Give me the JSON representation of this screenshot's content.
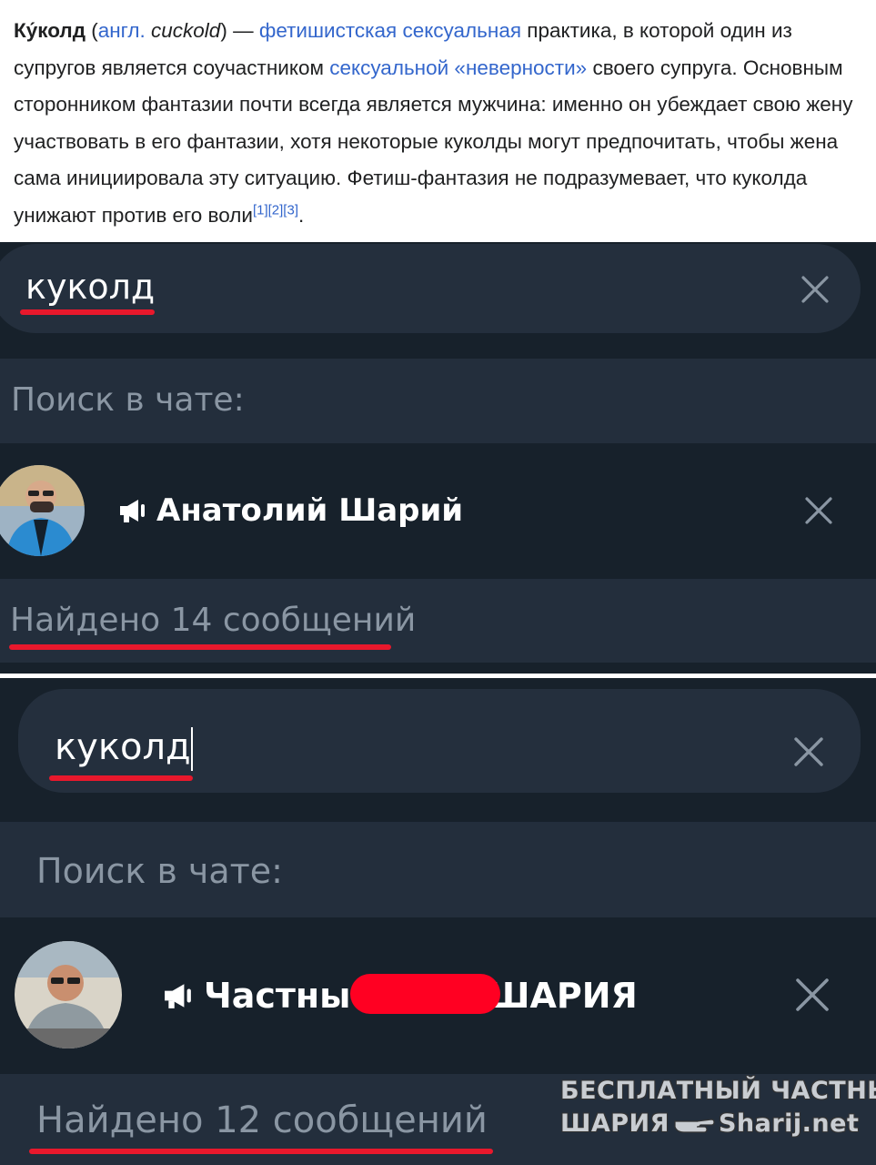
{
  "wiki": {
    "term": "Ку́колд",
    "open_paren": " (",
    "lang_abbr": "англ.",
    "space": " ",
    "english_term": "cuckold",
    "close_dash": ") — ",
    "link_fetish": "фетишистская сексуальная",
    "text1": " практика, в которой один из супругов является соучастником ",
    "link_infidelity": "сексуальной «неверности»",
    "text2": " своего супруга. Основным сторонником фантазии почти всегда является мужчина: именно он убеждает свою жену участвовать в его фантазии, хотя некоторые куколды могут предпочитать, чтобы жена сама инициировала эту ситуацию. Фетиш-фантазия не подразумевает, что куколда унижают против его воли",
    "refs": "[1][2][3]",
    "period": "."
  },
  "panel_top": {
    "search_query": "куколд",
    "search_hint": "Поиск в чате:",
    "chat_name": "Анатолий Шарий",
    "results_text": "Найдено 14 сообщений"
  },
  "panel_bottom": {
    "search_query": "куколд",
    "search_hint": "Поиск в чате:",
    "chat_name_left": "Частны",
    "chat_name_right": "ШАРИЯ",
    "results_text": "Найдено 12 сообщений"
  },
  "watermark": {
    "line1": "БЕСПЛАТНЫЙ  ЧАСТНЫЙ",
    "line2_left": "ШАРИЯ",
    "line2_right": "Sharij.net"
  },
  "colors": {
    "app_background": "#17212b",
    "band_background": "#232e3c",
    "searchbar": "#242f3d",
    "hint_text": "#8a96a3",
    "link": "#3366cc",
    "underline_red": "#e8182c"
  }
}
